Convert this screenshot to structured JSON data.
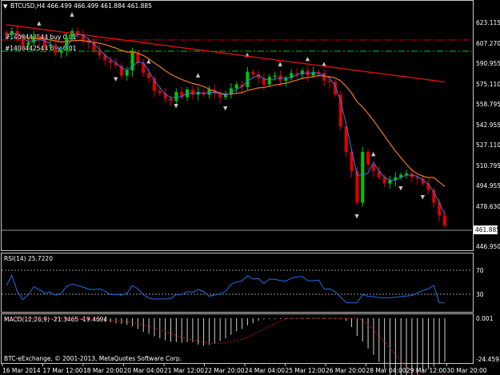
{
  "header": {
    "symbol_line": "BTCUSD,H4  466.499 466.499 461.884 461.885",
    "order_sell_label": "#1408442544 buy 0.01",
    "order_buy_label": "#1408442544 buy 0.01"
  },
  "main": {
    "y_ticks": [
      "623.115",
      "607.270",
      "590.955",
      "575.110",
      "558.795",
      "542.955",
      "527.110",
      "510.795",
      "494.955",
      "478.630",
      "461.885",
      "446.950"
    ],
    "current_price": "461.885"
  },
  "rsi": {
    "label": "RSI(14) 25.7220",
    "levels": [
      "70",
      "30"
    ]
  },
  "macd": {
    "label": "MACD(12,26,9) -21.3465 -19.4694",
    "y_ticks": [
      "0.001",
      "-24.4593"
    ]
  },
  "footer": {
    "copyright": "BTC-eExchange, © 2001-2013, MetaQuotes Software Corp.",
    "x_labels": [
      "16 Mar 2014",
      "17 Mar 12:00",
      "18 Mar 20:00",
      "20 Mar 04:00",
      "21 Mar 12:00",
      "22 Mar 20:00",
      "24 Mar 04:00",
      "25 Mar 12:00",
      "26 Mar 20:00",
      "28 Mar 04:00",
      "29 Mar 12:00",
      "30 Mar 20:00"
    ]
  },
  "colors": {
    "bull": "#00c800",
    "bear": "#e00000",
    "ma_slow": "#e81010",
    "ma_mid": "#f07820",
    "ma_fast": "#3c78f0",
    "rsi_line": "#1e6ee6",
    "macd_signal": "#c81414",
    "grid_text": "#ffffff"
  },
  "chart_data": [
    {
      "type": "candlestick",
      "title": "BTCUSD,H4",
      "ylim": [
        446.95,
        623.115
      ],
      "last_close": 461.885,
      "approx_closes": [
        612,
        615,
        610,
        604,
        606,
        611,
        608,
        603,
        604,
        598,
        600,
        610,
        615,
        612,
        608,
        606,
        600,
        596,
        592,
        590,
        588,
        580,
        584,
        598,
        590,
        582,
        578,
        568,
        566,
        562,
        560,
        567,
        563,
        569,
        565,
        567,
        565,
        569,
        566,
        563,
        565,
        570,
        573,
        571,
        583,
        581,
        578,
        573,
        579,
        580,
        576,
        578,
        582,
        581,
        584,
        580,
        583,
        582,
        576,
        575,
        565,
        540,
        520,
        505,
        480,
        520,
        510,
        505,
        500,
        495,
        498,
        500,
        502,
        503,
        500,
        499,
        495,
        490,
        480,
        470,
        462
      ]
    },
    {
      "type": "line",
      "title": "RSI(14)",
      "ylim": [
        0,
        100
      ],
      "levels": [
        70,
        30
      ],
      "last": 25.722
    },
    {
      "type": "bar",
      "title": "MACD(12,26,9)",
      "ylim": [
        -24.4593,
        0.001
      ],
      "main": -21.3465,
      "signal": -19.4694
    }
  ]
}
